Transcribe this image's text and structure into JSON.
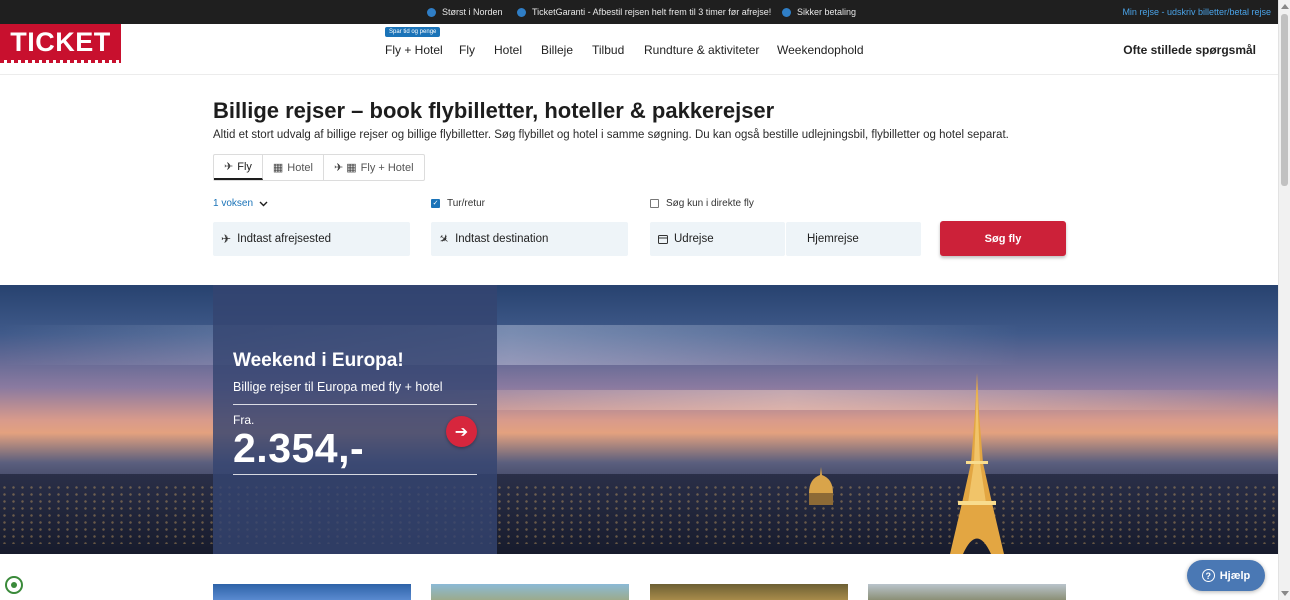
{
  "topbar": {
    "usps": [
      "Størst i Norden",
      "TicketGaranti - Afbestil rejsen helt frem til 3 timer før afrejse!",
      "Sikker betaling"
    ],
    "account_link": "Min rejse - udskriv billetter/betal rejse"
  },
  "header": {
    "logo_text": "TICKET",
    "nav_badge": "Spar tid og penge",
    "nav": [
      "Fly + Hotel",
      "Fly",
      "Hotel",
      "Billeje",
      "Tilbud",
      "Rundture & aktiviteter",
      "Weekendophold"
    ],
    "faq": "Ofte stillede spørgsmål"
  },
  "search": {
    "headline": "Billige rejser – book flybilletter, hoteller & pakkerejser",
    "subline": "Altid et stort udvalg af billige rejser og billige flybilletter. Søg flybillet og hotel i samme søgning. Du kan også bestille udlejningsbil, flybilletter og hotel separat.",
    "tabs": [
      "Fly",
      "Hotel",
      "Fly + Hotel"
    ],
    "passengers": "1 voksen",
    "roundtrip_label": "Tur/retur",
    "roundtrip_checked": true,
    "direct_label": "Søg kun i direkte fly",
    "direct_checked": false,
    "from_placeholder": "Indtast afrejsested",
    "to_placeholder": "Indtast destination",
    "depart_placeholder": "Udrejse",
    "return_placeholder": "Hjemrejse",
    "submit": "Søg fly"
  },
  "hero": {
    "title": "Weekend i Europa!",
    "subtitle": "Billige rejser til Europa med fly + hotel",
    "from_label": "Fra.",
    "price": "2.354,-"
  },
  "help": {
    "label": "Hjælp"
  },
  "colors": {
    "brand_red": "#c8102e",
    "button_red": "#cc2139",
    "link_blue": "#1a73b8",
    "topbar": "#1f1f1f"
  }
}
